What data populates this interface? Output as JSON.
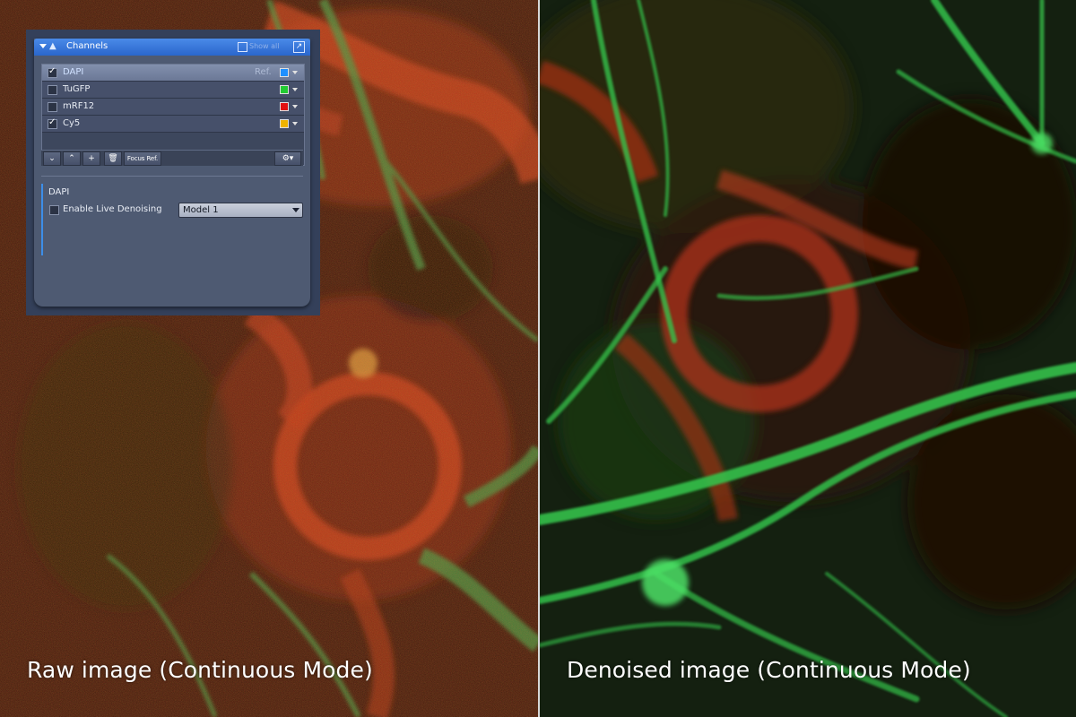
{
  "captions": {
    "left": "Raw image (Continuous Mode)",
    "right": "Denoised image (Continuous Mode)"
  },
  "channels_panel": {
    "title": "Channels",
    "show_all_label": "Show all",
    "channels": [
      {
        "name": "DAPI",
        "checked": true,
        "selected": true,
        "ref_label": "Ref.",
        "color": "#1e90ff"
      },
      {
        "name": "TuGFP",
        "checked": false,
        "selected": false,
        "ref_label": "",
        "color": "#22cc33"
      },
      {
        "name": "mRF12",
        "checked": false,
        "selected": false,
        "ref_label": "",
        "color": "#e01010"
      },
      {
        "name": "Cy5",
        "checked": true,
        "selected": false,
        "ref_label": "",
        "color": "#f0b400"
      }
    ],
    "toolbar": {
      "down_icon": "chevron-down-icon",
      "up_icon": "chevron-up-icon",
      "add_icon": "plus-icon",
      "delete_icon": "trash-icon",
      "focus_ref_label": "Focus Ref.",
      "settings_icon": "gear-icon"
    },
    "section_title": "DAPI",
    "denoise": {
      "label": "Enable Live Denoising",
      "checked": false,
      "model_value": "Model 1"
    }
  },
  "colors": {
    "panel_bg": "#4e5a72",
    "title_bar": "#2a66cc",
    "accent": "#3d8ee8",
    "raw_red": "#b52a10",
    "cyto_green": "#22c040"
  }
}
